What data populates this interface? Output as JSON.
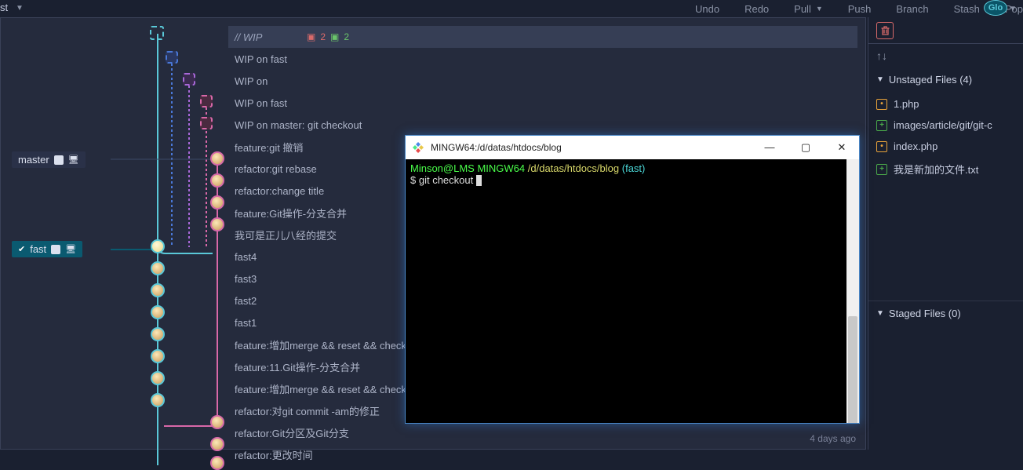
{
  "toolbar": {
    "undo": "Undo",
    "redo": "Redo",
    "pull": "Pull",
    "push": "Push",
    "branch": "Branch",
    "stash": "Stash",
    "pop": "Pop",
    "brand": "Glo"
  },
  "branches": {
    "master": "master",
    "fast": "fast"
  },
  "wip": {
    "label": "// WIP",
    "removed": "2",
    "added": "2"
  },
  "commits": [
    "WIP on fast",
    "WIP on",
    "WIP on fast",
    "WIP on master: git checkout",
    "feature:git 撤销",
    "refactor:git rebase",
    "refactor:change title",
    "feature:Git操作-分支合并",
    "我可是正儿八经的提交",
    "fast4",
    "fast3",
    "fast2",
    "fast1",
    "feature:增加merge && reset && checko",
    "feature:11.Git操作-分支合并",
    "feature:增加merge && reset && checko",
    "refactor:对git commit -am的修正",
    "refactor:Git分区及Git分支",
    "refactor:更改时间"
  ],
  "timestamp": "4 days ago",
  "sidebar": {
    "unstaged_header": "Unstaged Files (4)",
    "staged_header": "Staged Files (0)",
    "files": [
      {
        "icon": "mod",
        "name": "1.php"
      },
      {
        "icon": "add",
        "name": "images/article/git/git-c"
      },
      {
        "icon": "mod",
        "name": "index.php"
      },
      {
        "icon": "add",
        "name": "我是新加的文件.txt"
      }
    ]
  },
  "terminal": {
    "title": "MINGW64:/d/datas/htdocs/blog",
    "user": "Minson@LMS",
    "host": "MINGW64",
    "path": "/d/datas/htdocs/blog",
    "branch": "(fast)",
    "prompt": "$",
    "cmd": "git checkout"
  }
}
